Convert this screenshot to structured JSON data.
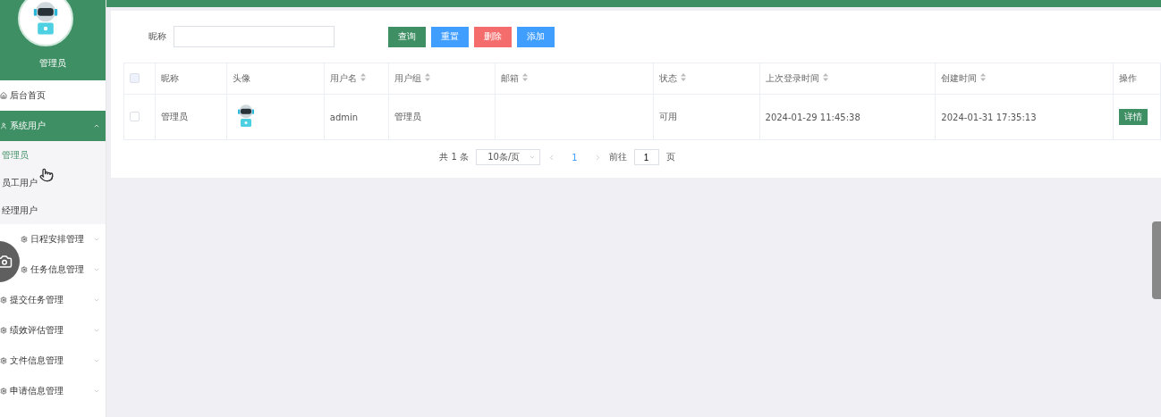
{
  "sidebar": {
    "user_name": "管理员",
    "items": [
      {
        "label": "后台首页",
        "kind": "link",
        "expanded": false
      },
      {
        "label": "系统用户",
        "kind": "group",
        "expanded": true,
        "children": [
          {
            "label": "管理员",
            "selected": true
          },
          {
            "label": "员工用户",
            "selected": false
          },
          {
            "label": "经理用户",
            "selected": false
          }
        ]
      },
      {
        "label": "日程安排管理",
        "kind": "group",
        "expanded": false
      },
      {
        "label": "任务信息管理",
        "kind": "group",
        "expanded": false
      },
      {
        "label": "提交任务管理",
        "kind": "group",
        "expanded": false
      },
      {
        "label": "绩效评估管理",
        "kind": "group",
        "expanded": false
      },
      {
        "label": "文件信息管理",
        "kind": "group",
        "expanded": false
      },
      {
        "label": "申请信息管理",
        "kind": "group",
        "expanded": false
      }
    ]
  },
  "search": {
    "label": "昵称"
  },
  "buttons": [
    {
      "label": "查询",
      "kind": "primary"
    },
    {
      "label": "重置",
      "kind": "info"
    },
    {
      "label": "删除",
      "kind": "danger"
    },
    {
      "label": "添加",
      "kind": "info"
    }
  ],
  "table": {
    "all_checked": false,
    "columns": [
      {
        "label": "昵称",
        "sortable": false
      },
      {
        "label": "头像",
        "sortable": false
      },
      {
        "label": "用户名",
        "sortable": true
      },
      {
        "label": "用户组",
        "sortable": true
      },
      {
        "label": "邮箱",
        "sortable": true
      },
      {
        "label": "状态",
        "sortable": true
      },
      {
        "label": "上次登录时间",
        "sortable": true
      },
      {
        "label": "创建时间",
        "sortable": true
      },
      {
        "label": "操作",
        "sortable": false
      }
    ],
    "rows": [
      {
        "checked": false,
        "cells": [
          "管理员",
          "",
          "admin",
          "管理员",
          "",
          "可用",
          "2024-01-29 11:45:38",
          "2024-01-31 17:35:13"
        ],
        "action": "详情"
      }
    ]
  },
  "pagination": {
    "total": "共 1 条",
    "page_size": "10条/页",
    "pages": [
      {
        "label": "1",
        "selected": true
      }
    ],
    "goto_label": "前往",
    "goto_value": "1",
    "goto_suffix": "页"
  }
}
